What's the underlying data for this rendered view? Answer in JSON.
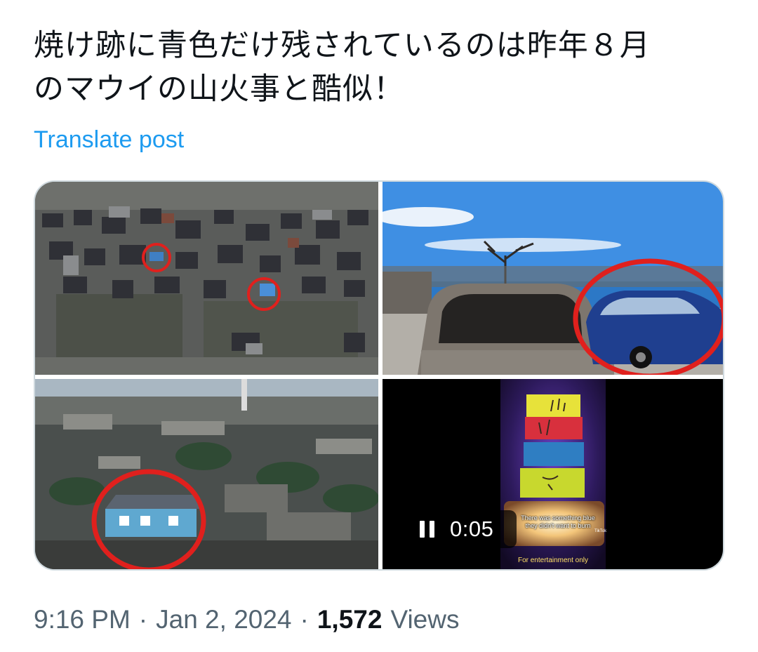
{
  "post": {
    "text_line1": "焼け跡に青色だけ残されているのは昨年８月",
    "text_line2": "のマウイの山火事と酷似！",
    "translate_label": "Translate post"
  },
  "media": {
    "video": {
      "time": "0:05",
      "caption": "There was something blue they didn't want to burn",
      "watermark": "TikTok",
      "disclaimer": "For entertainment only"
    }
  },
  "meta": {
    "time": "9:16 PM",
    "date": "Jan 2, 2024",
    "separator": "·",
    "views_count": "1,572",
    "views_label": "Views"
  },
  "colors": {
    "link": "#1d9bf0",
    "secondary_text": "#536471",
    "highlight_circle": "#e0201d"
  },
  "icons": [
    "pause-icon"
  ]
}
